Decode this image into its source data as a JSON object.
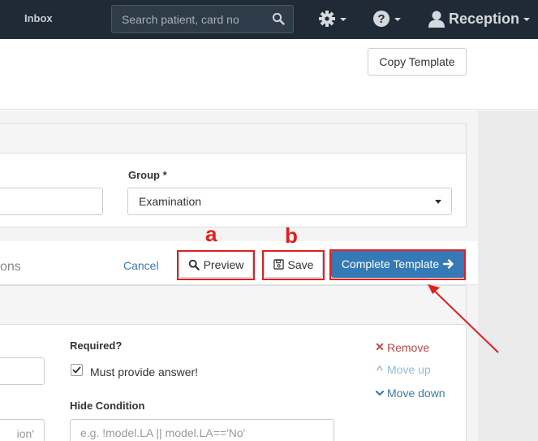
{
  "navbar": {
    "inbox_label": "Inbox",
    "search_placeholder": "Search patient, card no",
    "user_label": "Reception"
  },
  "toolbar": {
    "copy_label": "Copy Template"
  },
  "form": {
    "group_label": "Group *",
    "group_value": "Examination"
  },
  "actions": {
    "tab_fragment": "ons",
    "cancel_label": "Cancel",
    "preview_label": "Preview",
    "save_label": "Save",
    "complete_label": "Complete Template"
  },
  "annotations": {
    "a": "a",
    "b": "b",
    "highlight_color": "#e0201f"
  },
  "question": {
    "required_label": "Required?",
    "must_label": "Must provide answer!",
    "hide_label": "Hide Condition",
    "hide_placeholder": "e.g. !model.LA || model.LA=='No'",
    "left_fragment": "ion'",
    "remove_label": "Remove",
    "move_up_label": "Move up",
    "move_down_label": "Move down"
  },
  "colors": {
    "navbar_bg": "#1f2a36",
    "primary": "#337ab7",
    "link": "#3a79b6",
    "danger": "#b94a48"
  }
}
